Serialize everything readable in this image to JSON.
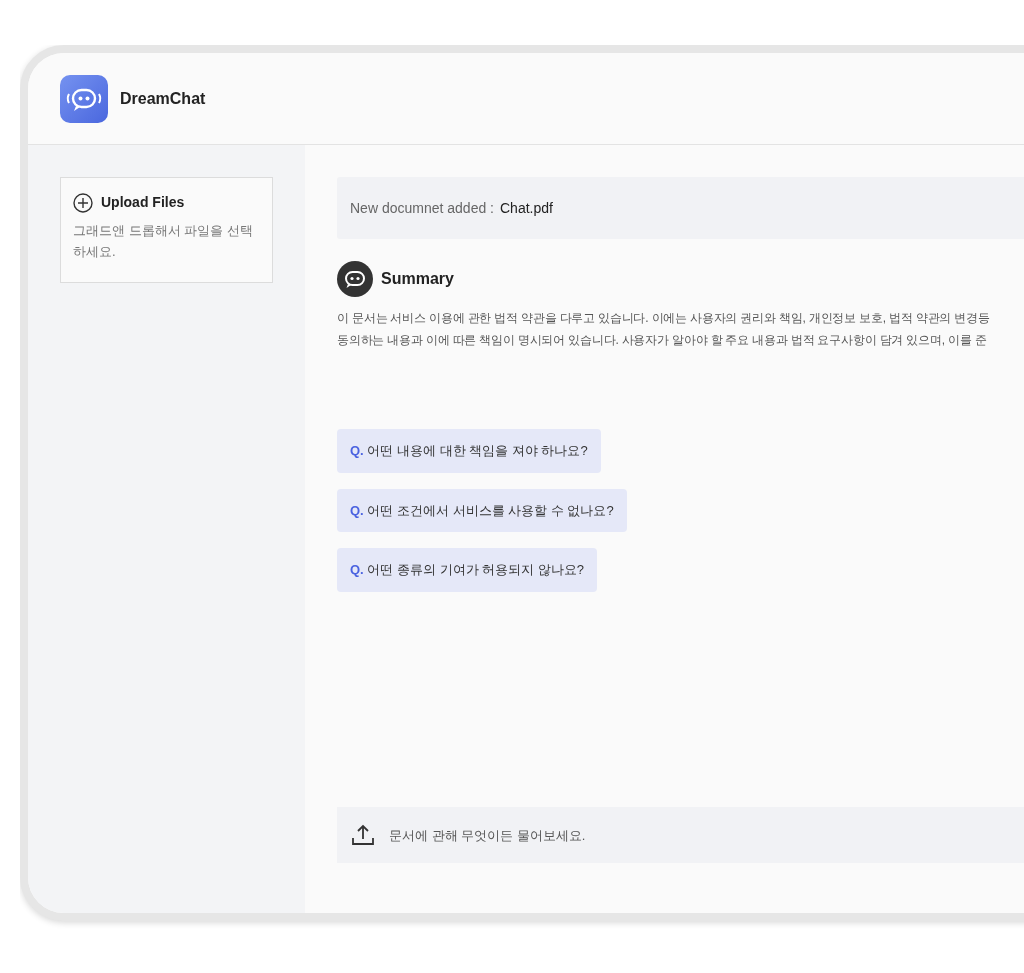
{
  "app": {
    "title": "DreamChat"
  },
  "sidebar": {
    "upload": {
      "label": "Upload Files",
      "hint": "그래드앤 드롭해서 파일을 선택하세요."
    }
  },
  "notice": {
    "label": "New documnet added :",
    "file": "Chat.pdf"
  },
  "summary": {
    "title": "Summary",
    "lines": [
      "이 문서는 서비스 이용에 관한 법적 약관을 다루고 있습니다. 이에는 사용자의 권리와 책임, 개인정보 보호, 법적 약관의 변경등",
      "동의하는 내용과  이에 따른 책임이 명시되어 있습니다. 사용자가 알아야 할 주요 내용과 법적 요구사항이 담겨 있으며, 이를 준"
    ]
  },
  "questions": [
    {
      "prefix": "Q.",
      "text": "어떤 내용에 대한 책임을 져야 하나요?"
    },
    {
      "prefix": "Q.",
      "text": "어떤 조건에서 서비스를 사용할 수 없나요?"
    },
    {
      "prefix": "Q.",
      "text": "어떤 종류의 기여가 허용되지 않나요?"
    }
  ],
  "input": {
    "placeholder": "문서에 관해 무엇이든 물어보세요."
  }
}
